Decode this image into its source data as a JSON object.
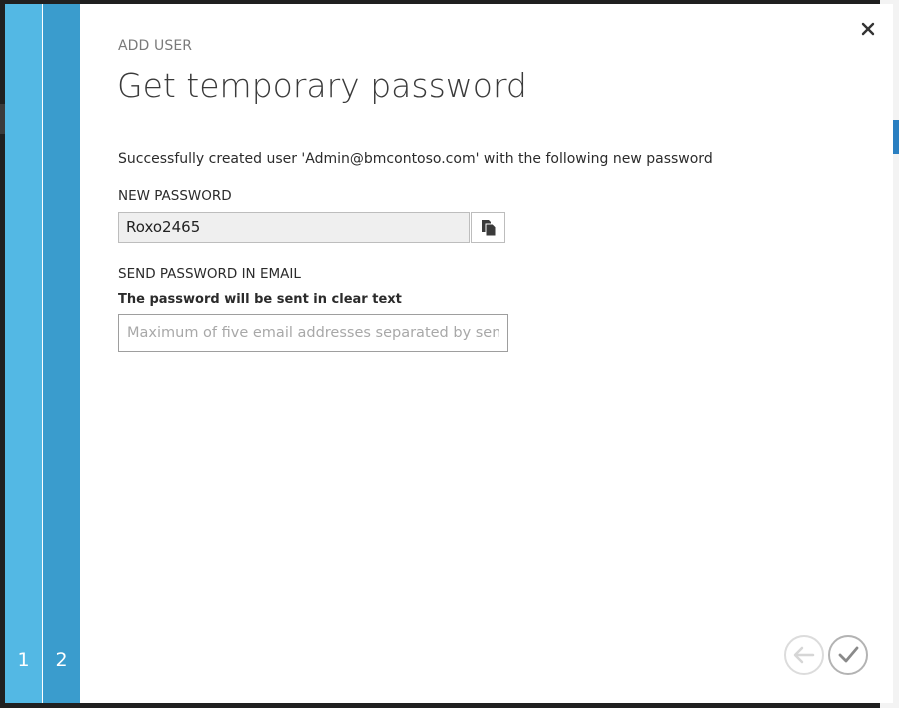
{
  "dialog": {
    "eyebrow": "ADD USER",
    "title": "Get temporary password",
    "message": "Successfully created user 'Admin@bmcontoso.com' with the following new password",
    "new_password": {
      "label": "NEW PASSWORD",
      "value": "Roxo2465",
      "copy_icon": "copy-icon"
    },
    "send_email": {
      "label": "SEND PASSWORD IN EMAIL",
      "note": "The password will be sent in clear text",
      "placeholder": "Maximum of five email addresses separated by semicolons"
    },
    "steps": [
      "1",
      "2"
    ],
    "current_step": "2",
    "close_icon": "close-icon",
    "back_icon": "back-arrow-icon",
    "complete_icon": "checkmark-icon"
  },
  "colors": {
    "step1": "#53b8e4",
    "step2": "#3a9ccd",
    "accent": "#2a7fc1"
  }
}
